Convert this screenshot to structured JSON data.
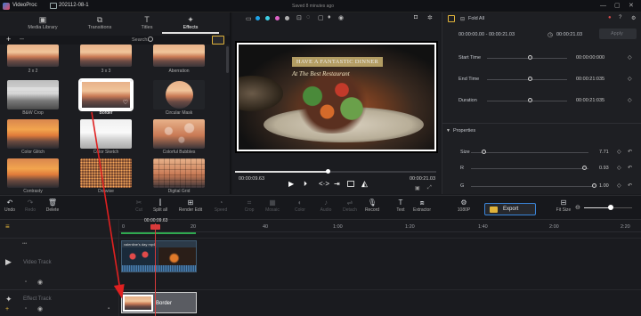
{
  "titlebar": {
    "app_name": "VideoProc",
    "project": "202112-08-1",
    "saved": "Saved 8 minutes ago",
    "minimize": "—",
    "maximize": "▢",
    "close": "✕"
  },
  "library": {
    "tabs": [
      {
        "label": "Media Library",
        "icon": "media-library-icon"
      },
      {
        "label": "Transitions",
        "icon": "transitions-icon"
      },
      {
        "label": "Titles",
        "icon": "titles-icon"
      },
      {
        "label": "Effects",
        "icon": "effects-icon"
      }
    ],
    "active_tab": "Effects",
    "search_label": "Search...",
    "effects": [
      {
        "label": "2 x 2"
      },
      {
        "label": "3 x 3"
      },
      {
        "label": "Aberration"
      },
      {
        "label": "B&W Crop"
      },
      {
        "label": "Border"
      },
      {
        "label": "Circular Mask"
      },
      {
        "label": "Color Glitch"
      },
      {
        "label": "Color Sketch"
      },
      {
        "label": "Colorful Bubbles"
      },
      {
        "label": "Contrasty"
      },
      {
        "label": "Dotwise"
      },
      {
        "label": "Digital Grid"
      }
    ],
    "selected_effect": "Border"
  },
  "player": {
    "overlay_title": "HAVE A FANTASTIC DINNER",
    "overlay_subtitle": "At The Best Restaurant",
    "current_time": "00:00:09.63",
    "total_time": "00:00:21.03",
    "progress": 0.46,
    "color_dots": [
      "#1fa3e8",
      "#3fd0e6",
      "#e063c8",
      "#b0b0b0"
    ]
  },
  "props": {
    "fold_all": "Fold All",
    "range": "00:00:00.00 - 00:00:21.03",
    "duration_readout": "00:00:21.03",
    "apply": "Apply",
    "start_time_label": "Start Time",
    "start_time_value": "00:00:00:000",
    "end_time_label": "End Time",
    "end_time_value": "00:00:21:035",
    "duration_label": "Duration",
    "duration_value": "00:00:21:035",
    "properties_title": "Properties",
    "size_label": "Size",
    "size_value": "7.71",
    "r_label": "R",
    "r_value": "0.93",
    "g_label": "G",
    "g_value": "1.00"
  },
  "toolbar": {
    "tools": [
      {
        "label": "Undo",
        "icon": "undo-icon",
        "enabled": true
      },
      {
        "label": "Redo",
        "icon": "redo-icon",
        "enabled": false
      },
      {
        "label": "Delete",
        "icon": "trash-icon",
        "enabled": true
      },
      {
        "label": "Cut",
        "icon": "scissors-icon",
        "enabled": false
      },
      {
        "label": "Split all",
        "icon": "split-all-icon",
        "enabled": true
      },
      {
        "label": "Render Edit",
        "icon": "render-edit-icon",
        "enabled": true
      },
      {
        "label": "Speed",
        "icon": "speed-icon",
        "enabled": false
      },
      {
        "label": "Crop",
        "icon": "crop-icon",
        "enabled": false
      },
      {
        "label": "Mosaic",
        "icon": "mosaic-icon",
        "enabled": false
      },
      {
        "label": "Color",
        "icon": "color-icon",
        "enabled": false
      },
      {
        "label": "Audio",
        "icon": "audio-icon",
        "enabled": false
      },
      {
        "label": "Detach",
        "icon": "detach-icon",
        "enabled": false
      },
      {
        "label": "Record",
        "icon": "microphone-icon",
        "enabled": true
      },
      {
        "label": "Text",
        "icon": "text-icon",
        "enabled": true
      },
      {
        "label": "Extractor",
        "icon": "extractor-icon",
        "enabled": true
      },
      {
        "label": "1080P",
        "icon": "resolution-icon",
        "enabled": true
      }
    ],
    "export_label": "Export",
    "fit_size": "Fit Size"
  },
  "timeline": {
    "playhead_time": "00:00:09.63",
    "ruler_labels": [
      "0",
      "20",
      "40",
      "1:00",
      "1:20",
      "1:40",
      "2:00",
      "2:20"
    ],
    "video_track_label": "Video Track",
    "effect_track_label": "Effect Track",
    "effect_clip_label": "Border",
    "video_clip_caption": "valentine's day mp4"
  },
  "colors": {
    "accent": "#3a84d8",
    "export": "#e0b33a",
    "playhead": "#d83a3a",
    "annotation_arrow": "#e02020"
  }
}
